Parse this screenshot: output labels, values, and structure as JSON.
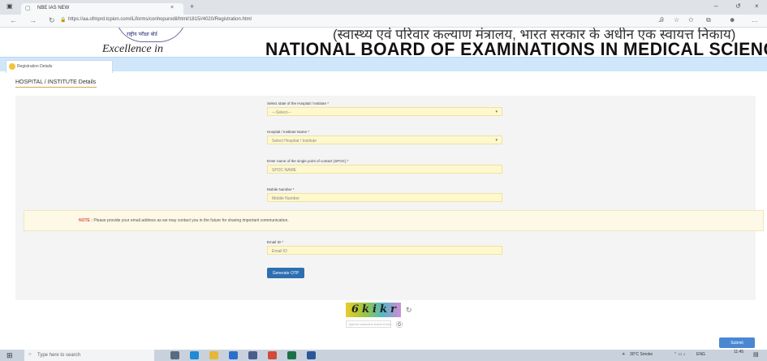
{
  "browser": {
    "tab_title": "NBE IAS NEW",
    "tab_close": "×",
    "new_tab": "+",
    "url": "https://aa.ofmprd.tcpion.com/iLiforms/conhopurodil/html/1815//4020/Registration.html",
    "nav": {
      "back": "←",
      "forward": "→",
      "reload": "↻"
    },
    "window_controls": {
      "minimize": "–",
      "restore": "↺",
      "close": "×"
    },
    "toolbar_icons": [
      "read-aloud-icon",
      "favorite-icon",
      "favorites-icon",
      "collections-icon",
      "profile-icon",
      "more-icon"
    ]
  },
  "banner": {
    "logo_text": "राष्ट्रीय परीक्षा बोर्ड",
    "tagline": "Excellence in",
    "hindi_line": "(स्वास्थ्य एवं परिवार कल्याण मंत्रालय, भारत सरकार के अधीन एक स्वायत्त निकाय)",
    "org_name": "NATIONAL BOARD OF EXAMINATIONS IN MEDICAL SCIENCES"
  },
  "header": {
    "reg_tab": "Registration Details"
  },
  "section": {
    "title": "HOSPITAL / INSTITUTE Details"
  },
  "form": {
    "state": {
      "label": "Select state of the Hospital / Institute *",
      "value": "---Select---"
    },
    "hospital": {
      "label": "Hospital / Institute Name *",
      "value": "Select Hospital / Institute"
    },
    "spoc": {
      "label": "Enter name of the single point of contact (SPOC) *",
      "placeholder": "SPOC NAME"
    },
    "mobile": {
      "label": "Mobile Number *",
      "placeholder": "Mobile Number"
    },
    "note": {
      "prefix": "NOTE :",
      "text": "Please provide your email address as we may contact you in the future for sharing important communication."
    },
    "email": {
      "label": "Email ID *",
      "placeholder": "Email ID"
    },
    "otp_button": "Generate OTP"
  },
  "captcha": {
    "text": "6kikr",
    "input_placeholder": "Type the characters shown in image",
    "refresh_icon": "refresh-icon",
    "audio_icon": "audio-icon"
  },
  "submit_button": "Submit",
  "taskbar": {
    "search_placeholder": "Type here to search",
    "weather": "30°C Smoke",
    "language": "ENG",
    "time": "11:45",
    "apps": [
      {
        "name": "task-view",
        "color": "#5b6b82"
      },
      {
        "name": "edge",
        "color": "#1f8ad6"
      },
      {
        "name": "file-explorer",
        "color": "#e8b63a"
      },
      {
        "name": "mail",
        "color": "#2c6fcb"
      },
      {
        "name": "store",
        "color": "#4a5d8c"
      },
      {
        "name": "chrome",
        "color": "#d44937"
      },
      {
        "name": "excel",
        "color": "#1e7145"
      },
      {
        "name": "word",
        "color": "#2b579a"
      }
    ]
  }
}
